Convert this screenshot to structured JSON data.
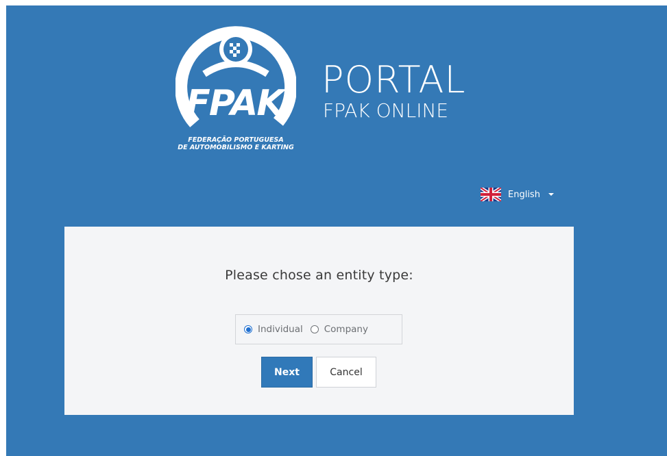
{
  "header": {
    "logo_text": "FPAK",
    "logo_caption_line1": "FEDERAÇÃO PORTUGUESA",
    "logo_caption_line2": "DE AUTOMOBILISMO E KARTING",
    "title": "PORTAL",
    "subtitle": "FPAK ONLINE"
  },
  "language": {
    "flag_icon": "uk-flag-icon",
    "label": "English"
  },
  "form": {
    "question": "Please chose an entity type:",
    "options": [
      {
        "label": "Individual",
        "checked": true
      },
      {
        "label": "Company",
        "checked": false
      }
    ],
    "next_label": "Next",
    "cancel_label": "Cancel"
  },
  "colors": {
    "background": "#3479b6",
    "card": "#f4f5f7",
    "primary_button": "#3179b9",
    "radio_selected": "#1f6fd0"
  }
}
